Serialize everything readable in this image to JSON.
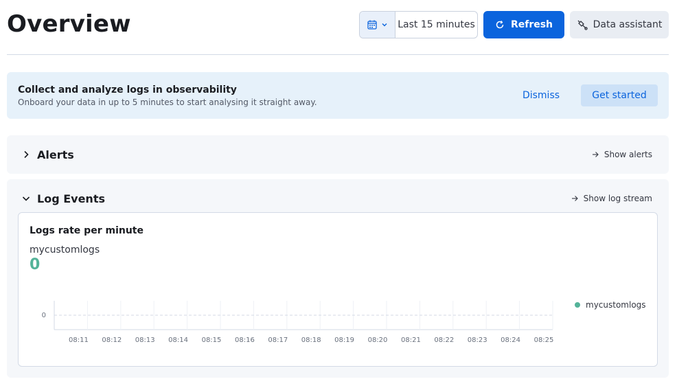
{
  "header": {
    "title": "Overview",
    "date_range": "Last 15 minutes",
    "date_icon": "calendar-icon",
    "refresh_label": "Refresh",
    "assistant_label": "Data assistant"
  },
  "callout": {
    "title": "Collect and analyze logs in observability",
    "text": "Onboard your data in up to 5 minutes to start analysing it straight away.",
    "dismiss_label": "Dismiss",
    "start_label": "Get started"
  },
  "alerts": {
    "title": "Alerts",
    "link": "Show alerts"
  },
  "log_events": {
    "title": "Log Events",
    "link": "Show log stream",
    "card_title": "Logs rate per minute",
    "metric_label": "mycustomlogs",
    "metric_value": "0",
    "legend_label": "mycustomlogs"
  },
  "colors": {
    "accent": "#0b64dd",
    "series": "#54b399",
    "callout_bg": "#e6f1fa"
  },
  "chart_data": {
    "type": "line",
    "x": [
      "08:11",
      "08:12",
      "08:13",
      "08:14",
      "08:15",
      "08:16",
      "08:17",
      "08:18",
      "08:19",
      "08:20",
      "08:21",
      "08:22",
      "08:23",
      "08:24",
      "08:25"
    ],
    "series": [
      {
        "name": "mycustomlogs",
        "values": [
          0,
          0,
          0,
          0,
          0,
          0,
          0,
          0,
          0,
          0,
          0,
          0,
          0,
          0,
          0
        ]
      }
    ],
    "y_ticks": [
      "0"
    ],
    "ylim": [
      0,
      1
    ],
    "grid": true,
    "legend": "right"
  }
}
